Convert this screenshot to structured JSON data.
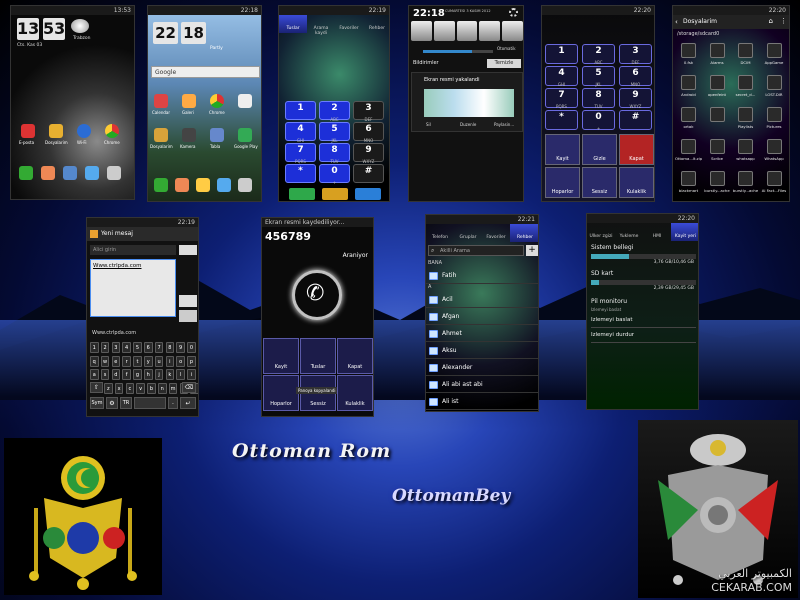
{
  "colors": {
    "accent": "#2a3fd6",
    "call_red": "#d42a2a",
    "call_green": "#2ea84a",
    "bg_dark": "#040a33"
  },
  "screens": {
    "home1": {
      "status_time": "13:53",
      "clock_h": "13",
      "clock_m": "53",
      "date": "Cts. Kas 03",
      "weather": "Trabzon",
      "labels": [
        "E-posta",
        "Dosyalarim",
        "Wi-Fi",
        "Chrome"
      ]
    },
    "home2": {
      "status_time": "22:18",
      "clock_h": "22",
      "clock_m": "18",
      "weather": "Partly",
      "search": "Google",
      "labels": [
        "Calendar",
        "Galeri",
        "Chrome",
        "",
        "Dosyalarim",
        "Kamera",
        "Tabla",
        "Google Play"
      ]
    },
    "dialer1": {
      "status_time": "22:19",
      "tabs": [
        "Tuslar",
        "Arama kaydi",
        "Favoriler",
        "Rehber"
      ],
      "keys": [
        "1",
        "2",
        "3",
        "4",
        "5",
        "6",
        "7",
        "8",
        "9",
        "*",
        "0",
        "#"
      ],
      "subs": [
        "",
        "ABC",
        "DEF",
        "GHI",
        "JKL",
        "MNO",
        "PQRS",
        "TUV",
        "WXYZ",
        "",
        "+",
        ""
      ]
    },
    "notif": {
      "time": "22:18",
      "date": "CUMARTESI 3 KASIM 2012",
      "auto": "Otomatik",
      "tab1": "Bildirimler",
      "tab2": "Temizle",
      "shot": "Ekran resmi yakalandi",
      "act1": "Sil",
      "act2": "Duzenle",
      "act3": "Paylasin..."
    },
    "dialer2": {
      "status_time": "22:20",
      "keys": [
        "1",
        "2",
        "3",
        "4",
        "5",
        "6",
        "7",
        "8",
        "9",
        "*",
        "0",
        "#"
      ],
      "subs": [
        "",
        "ABC",
        "DEF",
        "GHI",
        "JKL",
        "MNO",
        "PQRS",
        "TUV",
        "WXYZ",
        "",
        "+",
        ""
      ],
      "btns": [
        "Kayit",
        "Gizle",
        "Kapat",
        "Hoparlor",
        "Sessiz",
        "Kulaklik"
      ]
    },
    "files": {
      "status_time": "22:20",
      "title": "Dosyalarim",
      "path": "/storage/sdcard0",
      "items": [
        "0.fsk",
        "Alarms",
        "DCIM",
        "AppGame",
        "Android",
        "openfeint",
        "secret_d...",
        "LOST.DIR",
        "ortak",
        "",
        "Playlists",
        "Pictures",
        "Ottoma...lt.zip",
        "Scribe",
        "whatsapp",
        "WhatsApp",
        "blackmart",
        "burstly...ache",
        "burstly...ache",
        "Ai Fact...Files"
      ]
    },
    "msg": {
      "status_time": "22:19",
      "title": "Yeni mesaj",
      "to_ph": "Alici girin",
      "body": "Www.ctrlpda.com",
      "suggest": "Www.ctrlpda.com",
      "rows": [
        [
          "1",
          "2",
          "3",
          "4",
          "5",
          "6",
          "7",
          "8",
          "9",
          "0"
        ],
        [
          "q",
          "w",
          "e",
          "r",
          "t",
          "y",
          "u",
          "i",
          "o",
          "p"
        ],
        [
          "a",
          "s",
          "d",
          "f",
          "g",
          "h",
          "j",
          "k",
          "l",
          "i"
        ],
        [
          "z",
          "x",
          "c",
          "v",
          "b",
          "n",
          "m",
          "o",
          "c"
        ]
      ],
      "sym": "Sym",
      "tr": "TR"
    },
    "calling": {
      "header": "Ekran resmi kaydediliyor...",
      "number": "456789",
      "status": "Araniyor",
      "btns": [
        "Kayit",
        "Tuslar",
        "Kapat",
        "Hoparlor",
        "Sessiz",
        "Kulaklik"
      ],
      "toast": "Panoya kopyalandi"
    },
    "contacts": {
      "status_time": "22:21",
      "tabs": [
        "Telefon",
        "Gruplar",
        "Favoriler",
        "Rehber"
      ],
      "search": "Akilli Arama",
      "section_b": "BANA",
      "section_a": "A",
      "names": [
        "Fatih",
        "Acil",
        "Afgan",
        "Ahmet",
        "Aksu",
        "Alexander",
        "Ali abi ast abi",
        "Ali ist"
      ]
    },
    "storage": {
      "status_time": "22:20",
      "tabs": [
        "Ulker zgizi",
        "Yukleme",
        "HMI",
        "Kayit yeri"
      ],
      "sys": "Sistem bellegi",
      "sys_val": "3,76 GB/10,46 GB",
      "sd": "SD kart",
      "sd_val": "2,39 GB/29,45 GB",
      "pil": "Pil monitoru",
      "pil_sub": "Izlemeyi baslat",
      "start": "Izlemeyi baslat",
      "stop": "Izlemeyi durdur"
    }
  },
  "signature_1": "Ottoman Rom",
  "signature_2": "OttomanBey",
  "watermark": "CEKARAB.COM",
  "watermark_ar": "الكمبيوتر العربي"
}
